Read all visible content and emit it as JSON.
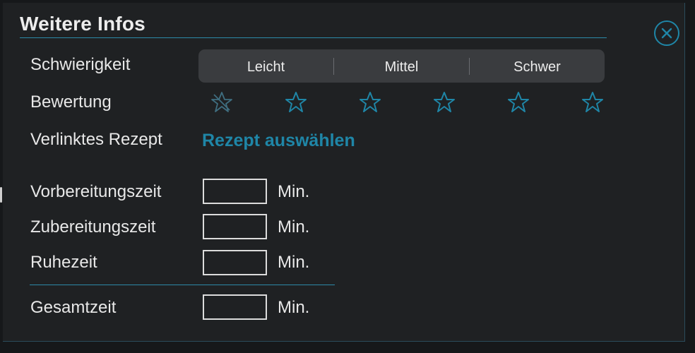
{
  "dialog": {
    "title": "Weitere Infos",
    "close_icon": "close-circle-icon"
  },
  "difficulty": {
    "label": "Schwierigkeit",
    "options": [
      "Leicht",
      "Mittel",
      "Schwer"
    ]
  },
  "rating": {
    "label": "Bewertung",
    "star_count": 6,
    "first_star": "star-cleared-icon",
    "star_icon": "star-outline-icon",
    "value": 0
  },
  "linked_recipe": {
    "label": "Verlinktes Rezept",
    "link_text": "Rezept auswählen"
  },
  "times": {
    "prep": {
      "label": "Vorbereitungszeit",
      "value": "",
      "unit": "Min."
    },
    "cook": {
      "label": "Zubereitungszeit",
      "value": "",
      "unit": "Min."
    },
    "rest": {
      "label": "Ruhezeit",
      "value": "",
      "unit": "Min."
    },
    "total": {
      "label": "Gesamtzeit",
      "value": "",
      "unit": "Min."
    }
  },
  "colors": {
    "accent": "#1f86a7",
    "background": "#1f2123",
    "segmented_bg": "#3a3c3f"
  }
}
